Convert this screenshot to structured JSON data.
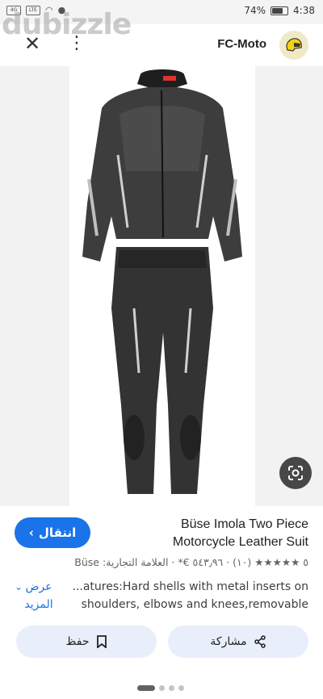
{
  "status_bar": {
    "battery_text": "74%",
    "time": "4:38",
    "battery_level": 0.74
  },
  "watermark": {
    "text": "dubizzle"
  },
  "top_bar": {
    "source_name": "FC-Moto"
  },
  "product": {
    "visit_label": "انتقال",
    "title": "Büse Imola Two Piece Motorcycle Leather Suit",
    "meta": "٥ ★★★★★ (١٠) · ٥٤٣٫٩٦ €* · العلامة التجارية: Büse",
    "description_line1": "...atures:Hard shells with metal inserts on",
    "description_line2": "shoulders, elbows and knees,removable",
    "more_label": "عرض المزيد",
    "rating_stars": 5
  },
  "actions": {
    "save_label": "حفظ",
    "share_label": "مشاركة"
  },
  "pagination": {
    "total": 4,
    "active": 0
  },
  "colors": {
    "accent": "#1a73e8",
    "chip_bg": "#e8effa",
    "star": "#f5a623"
  }
}
